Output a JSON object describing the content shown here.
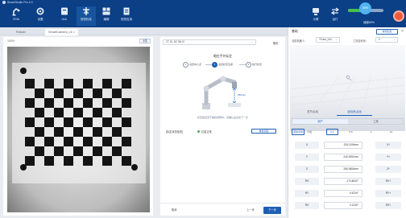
{
  "app": {
    "title": "SmartStudio Pro 4.0"
  },
  "toolbar": {
    "buttons": [
      {
        "label": "CRIA",
        "icon": "robot-icon"
      },
      {
        "label": "设置",
        "icon": "gear-icon"
      },
      {
        "label": "UUL",
        "icon": "module-icon"
      },
      {
        "label": "视觉标定",
        "icon": "calibration-icon"
      },
      {
        "label": "编辑",
        "icon": "grid-icon"
      },
      {
        "label": "视觉应用",
        "icon": "document-icon"
      }
    ],
    "right_buttons": [
      {
        "label": "示教",
        "icon": "teach-icon"
      },
      {
        "label": "运行",
        "icon": "run-icon"
      },
      {
        "label": "速度50%",
        "icon": "speed-icon"
      }
    ],
    "speed_progress": 0.45,
    "knob_label": "50%"
  },
  "tabs": [
    {
      "label": "Robot×",
      "active": false
    },
    {
      "label": "SmartCamera_v1 ×",
      "active": true
    }
  ],
  "camera_panel": {
    "zoom": "100% ·",
    "action_label": "采集"
  },
  "middle_panel": {
    "config_select": "ZT GL DC B6 IV",
    "config_link": "删除",
    "title": "眼在手外标定",
    "steps": [
      {
        "num": "1",
        "label": "设置中心点",
        "active": false
      },
      {
        "num": "2",
        "label": "设置标定位姿",
        "active": true
      },
      {
        "num": "3",
        "label": "执行标定",
        "active": false
      }
    ],
    "distance_label": "250mm",
    "note": "标定板应置于相机视野中，请确认后点击下一步",
    "status_label": "[标定状态检查]",
    "status_value": "位姿正常",
    "verify_label": "重新获取",
    "cancel_label": "取消",
    "prev_label": "上一步",
    "next_label": "下一步"
  },
  "right_panel": {
    "title": "基础",
    "save_label": "保存配置",
    "robot_field_label": "当前机器人：",
    "robot_select": "YCam_Uni",
    "tool_field_label": "工具坐标系：",
    "tool_select": "0",
    "sub_tabs": [
      "关节点动",
      "坐标系点动"
    ],
    "sub_tab_active": 1,
    "segments": [
      "用户",
      "工具"
    ],
    "segment_active": 0,
    "jog_label": "连续点动",
    "step_label": "寸动",
    "step_options": [
      "0.1",
      "0.5",
      "1",
      "10"
    ],
    "step_active": 0,
    "axes": [
      {
        "name": "X",
        "value": "315.1190mm",
        "minus": "X-",
        "plus": "X+"
      },
      {
        "name": "Y",
        "value": "245.3991mm",
        "minus": "Y-",
        "plus": "Y+"
      },
      {
        "name": "Z",
        "value": "265.3684mm",
        "minus": "Z-",
        "plus": "Z+"
      },
      {
        "name": "RX",
        "value": "-170.8042°",
        "minus": "RX-",
        "plus": "RX+"
      },
      {
        "name": "RY",
        "value": "0.4234°",
        "minus": "RY-",
        "plus": "RY+"
      },
      {
        "name": "RZ",
        "value": "0.1245°",
        "minus": "RZ-",
        "plus": "RZ+"
      }
    ]
  },
  "colors": {
    "topbar": "#0b3f86",
    "accent": "#1e5fb5",
    "ok": "#3dbb3f",
    "stop": "#ef5a3d"
  }
}
